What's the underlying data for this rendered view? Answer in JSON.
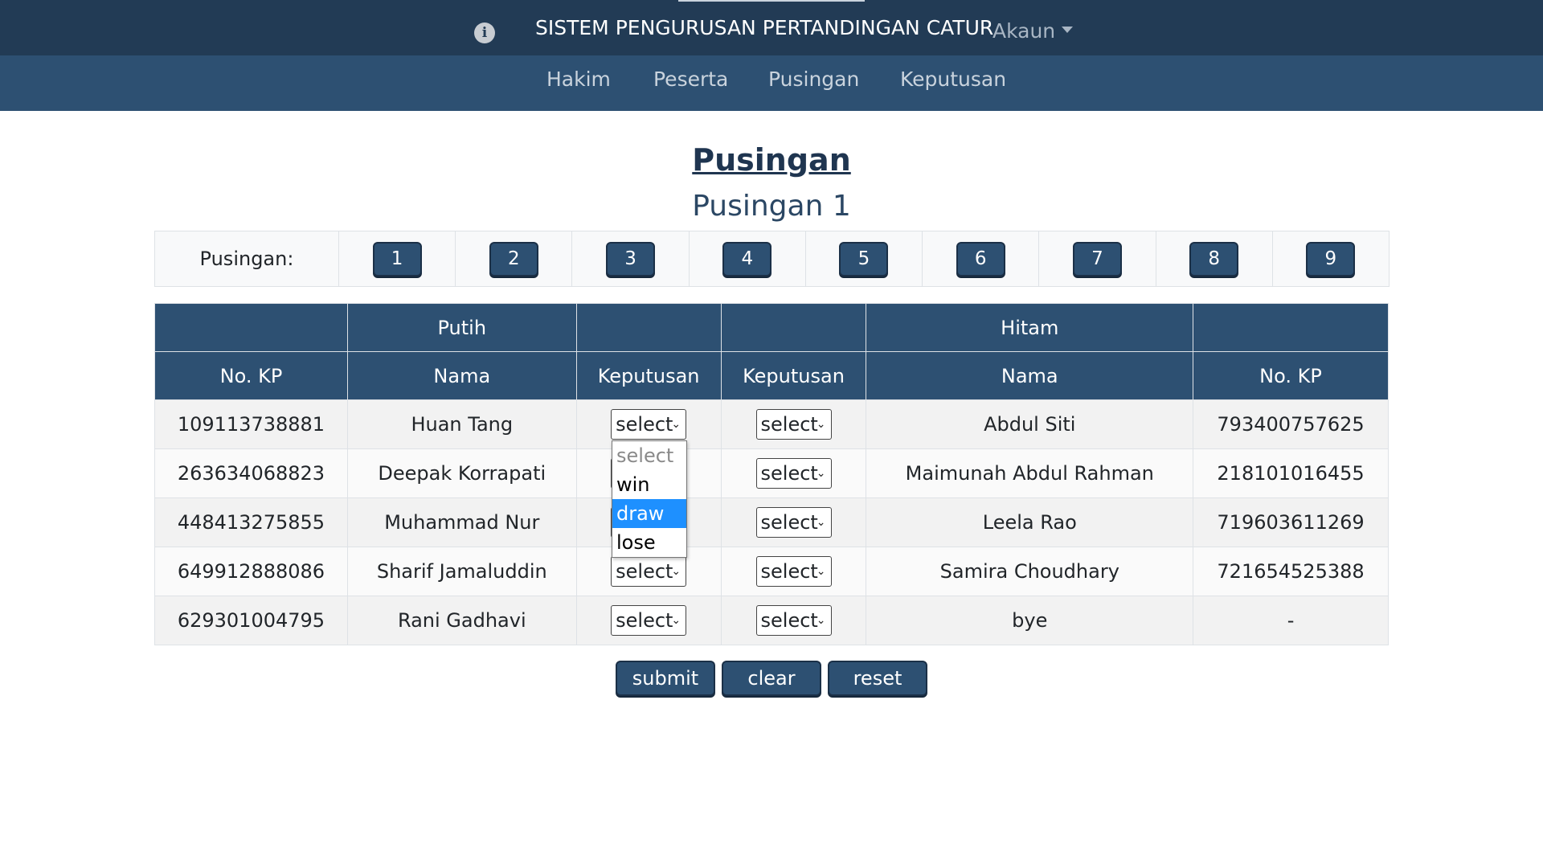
{
  "header": {
    "title": "SISTEM PENGURUSAN PERTANDINGAN CATUR",
    "account_label": "Akaun"
  },
  "nav": {
    "items": [
      {
        "label": "Hakim"
      },
      {
        "label": "Peserta"
      },
      {
        "label": "Pusingan"
      },
      {
        "label": "Keputusan"
      }
    ]
  },
  "page": {
    "title": "Pusingan",
    "subtitle": "Pusingan 1"
  },
  "round_selector": {
    "label": "Pusingan:",
    "rounds": [
      "1",
      "2",
      "3",
      "4",
      "5",
      "6",
      "7",
      "8",
      "9"
    ]
  },
  "table": {
    "group_headers": {
      "white": "Putih",
      "black": "Hitam"
    },
    "columns": {
      "white_id": "No. KP",
      "white_name": "Nama",
      "white_result": "Keputusan",
      "black_result": "Keputusan",
      "black_name": "Nama",
      "black_id": "No. KP"
    },
    "rows": [
      {
        "white_id": "109113738881",
        "white_name": "Huan Tang",
        "white_result": "select",
        "black_result": "select",
        "black_name": "Abdul Siti",
        "black_id": "793400757625"
      },
      {
        "white_id": "263634068823",
        "white_name": "Deepak Korrapati",
        "white_result": "select",
        "black_result": "select",
        "black_name": "Maimunah Abdul Rahman",
        "black_id": "218101016455"
      },
      {
        "white_id": "448413275855",
        "white_name": "Muhammad Nur",
        "white_result": "select",
        "black_result": "select",
        "black_name": "Leela Rao",
        "black_id": "719603611269"
      },
      {
        "white_id": "649912888086",
        "white_name": "Sharif Jamaluddin",
        "white_result": "select",
        "black_result": "select",
        "black_name": "Samira Choudhary",
        "black_id": "721654525388"
      },
      {
        "white_id": "629301004795",
        "white_name": "Rani Gadhavi",
        "white_result": "select",
        "black_result": "select",
        "black_name": "bye",
        "black_id": "-"
      }
    ]
  },
  "dropdown": {
    "options": [
      "select",
      "win",
      "draw",
      "lose"
    ],
    "highlighted": "draw"
  },
  "actions": {
    "submit_label": "submit",
    "clear_label": "clear",
    "reset_label": "reset"
  },
  "colors": {
    "topbar": "#223b55",
    "navbar": "#2d5072",
    "button": "#2d5072",
    "highlight": "#1e90ff"
  }
}
